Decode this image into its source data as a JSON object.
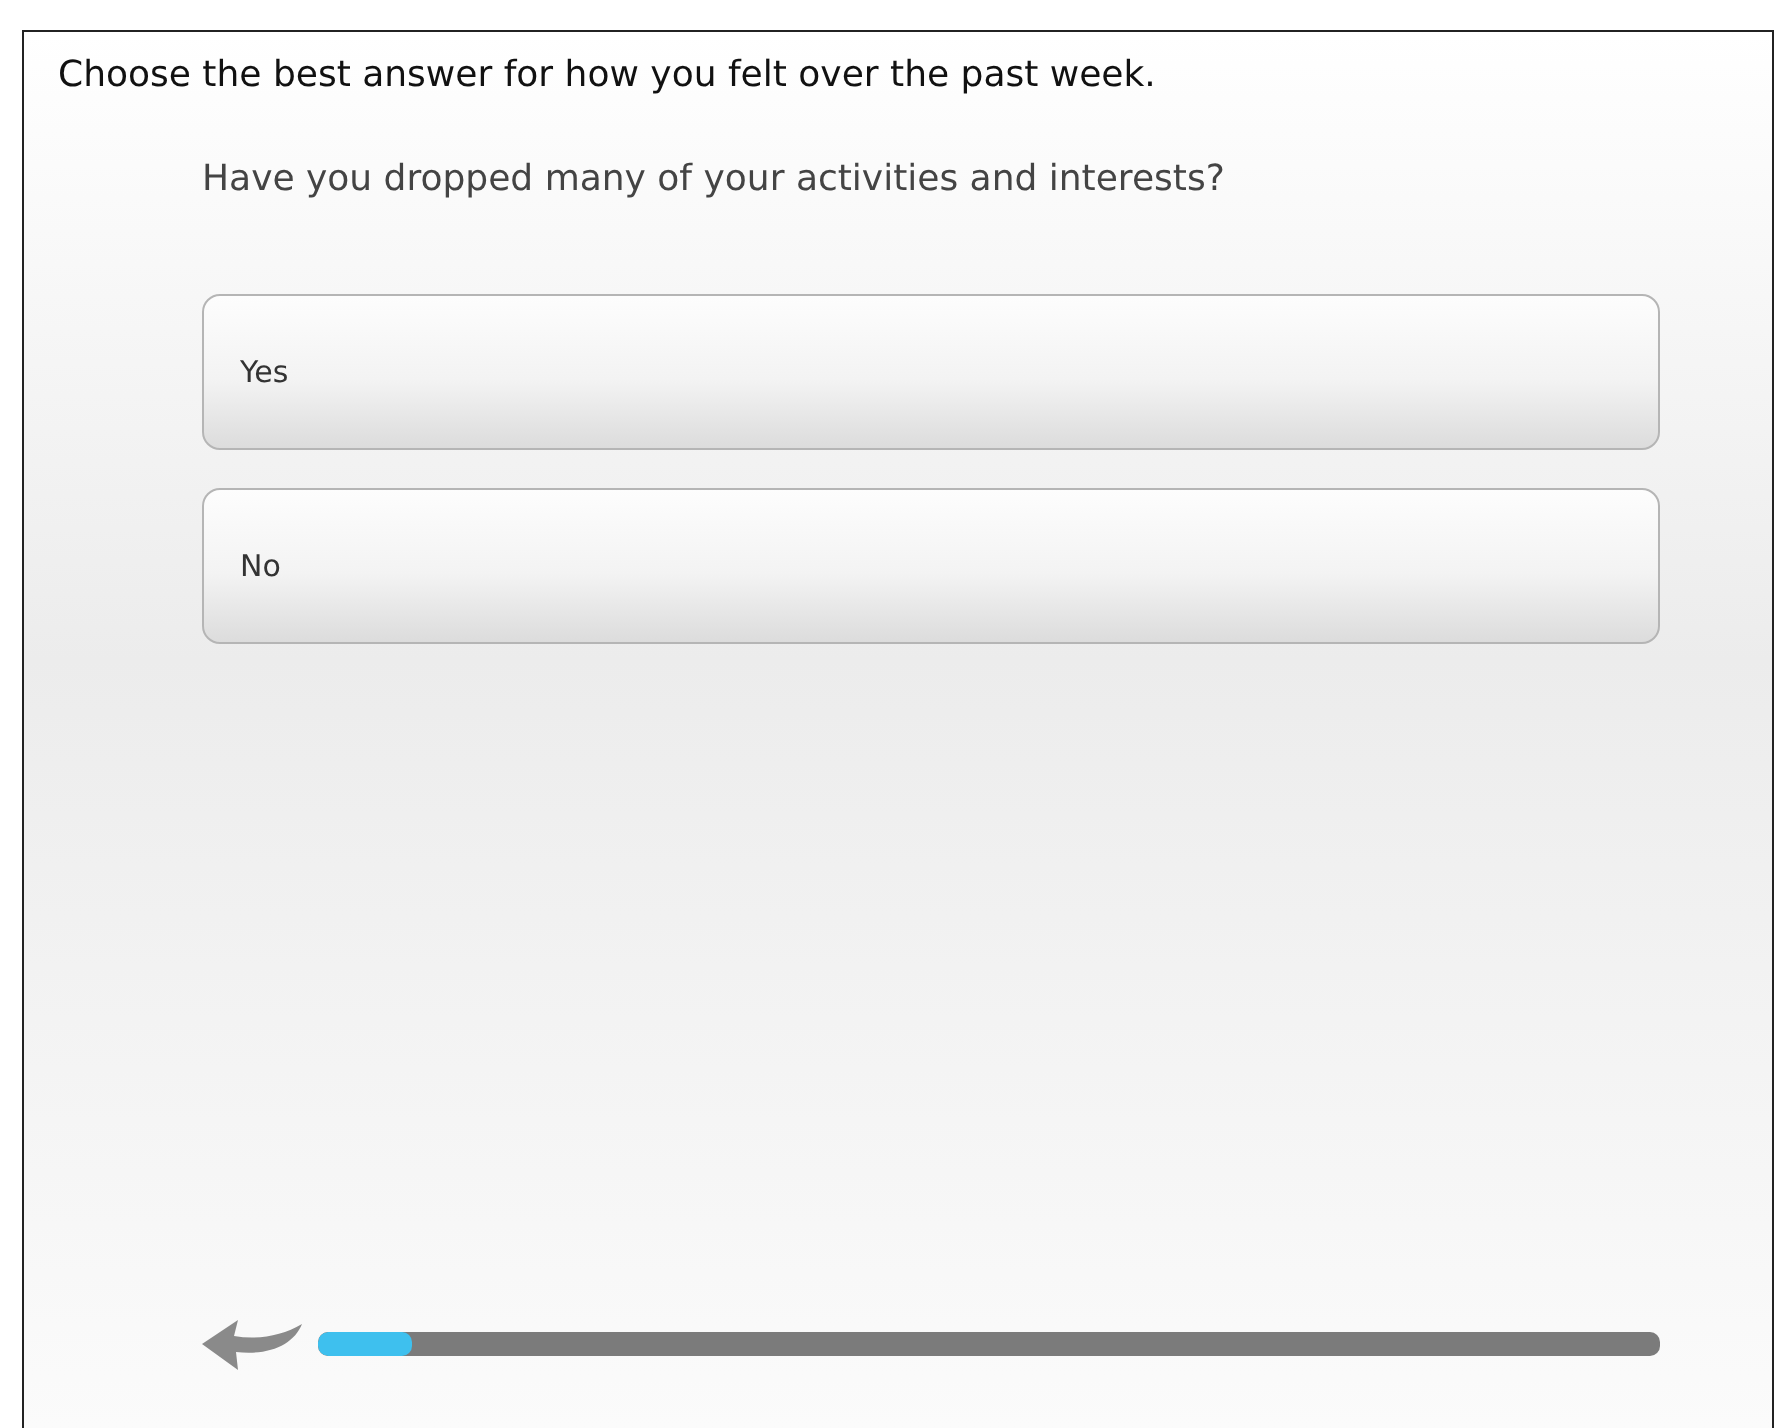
{
  "instruction": "Choose the best answer for how you felt over the past week.",
  "question": "Have you dropped many of your activities and interests?",
  "options": [
    {
      "label": "Yes",
      "selected": false
    },
    {
      "label": "No",
      "selected": false
    }
  ],
  "progress": {
    "level": 0.07
  }
}
